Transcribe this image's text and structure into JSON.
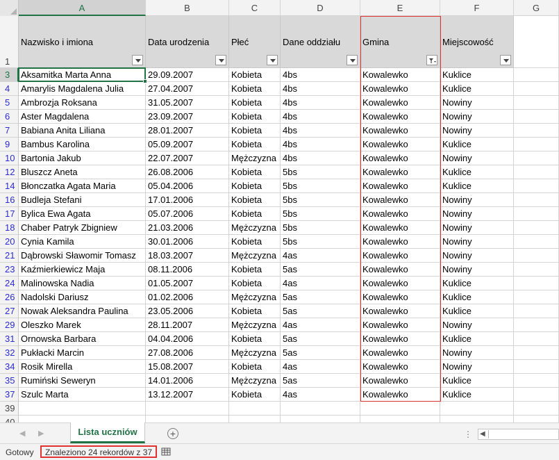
{
  "columns": [
    {
      "letter": "A",
      "header": "Nazwisko i imiona"
    },
    {
      "letter": "B",
      "header": "Data urodzenia"
    },
    {
      "letter": "C",
      "header": "Płeć"
    },
    {
      "letter": "D",
      "header": "Dane oddziału"
    },
    {
      "letter": "E",
      "header": "Gmina"
    },
    {
      "letter": "F",
      "header": "Miejscowość"
    },
    {
      "letter": "G",
      "header": ""
    }
  ],
  "header_row_number": "1",
  "active_filter_column": "E",
  "rows": [
    {
      "n": "3",
      "cells": [
        "Aksamitka Marta Anna",
        "29.09.2007",
        "Kobieta",
        "4bs",
        "Kowalewko",
        "Kuklice"
      ]
    },
    {
      "n": "4",
      "cells": [
        "Amarylis Magdalena Julia",
        "27.04.2007",
        "Kobieta",
        "4bs",
        "Kowalewko",
        "Kuklice"
      ]
    },
    {
      "n": "5",
      "cells": [
        "Ambrozja Roksana",
        "31.05.2007",
        "Kobieta",
        "4bs",
        "Kowalewko",
        "Nowiny"
      ]
    },
    {
      "n": "6",
      "cells": [
        "Aster Magdalena",
        "23.09.2007",
        "Kobieta",
        "4bs",
        "Kowalewko",
        "Nowiny"
      ]
    },
    {
      "n": "7",
      "cells": [
        "Babiana Anita Liliana",
        "28.01.2007",
        "Kobieta",
        "4bs",
        "Kowalewko",
        "Nowiny"
      ]
    },
    {
      "n": "9",
      "cells": [
        "Bambus Karolina",
        "05.09.2007",
        "Kobieta",
        "4bs",
        "Kowalewko",
        "Kuklice"
      ]
    },
    {
      "n": "10",
      "cells": [
        "Bartonia Jakub",
        "22.07.2007",
        "Mężczyzna",
        "4bs",
        "Kowalewko",
        "Nowiny"
      ]
    },
    {
      "n": "12",
      "cells": [
        "Bluszcz Aneta",
        "26.08.2006",
        "Kobieta",
        "5bs",
        "Kowalewko",
        "Kuklice"
      ]
    },
    {
      "n": "14",
      "cells": [
        "Błonczatka Agata Maria",
        "05.04.2006",
        "Kobieta",
        "5bs",
        "Kowalewko",
        "Kuklice"
      ]
    },
    {
      "n": "16",
      "cells": [
        "Budleja Stefani",
        "17.01.2006",
        "Kobieta",
        "5bs",
        "Kowalewko",
        "Nowiny"
      ]
    },
    {
      "n": "17",
      "cells": [
        "Bylica Ewa Agata",
        "05.07.2006",
        "Kobieta",
        "5bs",
        "Kowalewko",
        "Nowiny"
      ]
    },
    {
      "n": "18",
      "cells": [
        "Chaber Patryk Zbigniew",
        "21.03.2006",
        "Mężczyzna",
        "5bs",
        "Kowalewko",
        "Nowiny"
      ]
    },
    {
      "n": "20",
      "cells": [
        "Cynia Kamila",
        "30.01.2006",
        "Kobieta",
        "5bs",
        "Kowalewko",
        "Nowiny"
      ]
    },
    {
      "n": "21",
      "cells": [
        "Dąbrowski Sławomir Tomasz",
        "18.03.2007",
        "Mężczyzna",
        "4as",
        "Kowalewko",
        "Nowiny"
      ]
    },
    {
      "n": "23",
      "cells": [
        "Kaźmierkiewicz Maja",
        "08.11.2006",
        "Kobieta",
        "5as",
        "Kowalewko",
        "Nowiny"
      ]
    },
    {
      "n": "24",
      "cells": [
        "Malinowska Nadia",
        "01.05.2007",
        "Kobieta",
        "4as",
        "Kowalewko",
        "Kuklice"
      ]
    },
    {
      "n": "26",
      "cells": [
        "Nadolski Dariusz",
        "01.02.2006",
        "Mężczyzna",
        "5as",
        "Kowalewko",
        "Kuklice"
      ]
    },
    {
      "n": "27",
      "cells": [
        "Nowak Aleksandra Paulina",
        "23.05.2006",
        "Kobieta",
        "5as",
        "Kowalewko",
        "Kuklice"
      ]
    },
    {
      "n": "29",
      "cells": [
        "Oleszko Marek",
        "28.11.2007",
        "Mężczyzna",
        "4as",
        "Kowalewko",
        "Nowiny"
      ]
    },
    {
      "n": "31",
      "cells": [
        "Ornowska Barbara",
        "04.04.2006",
        "Kobieta",
        "5as",
        "Kowalewko",
        "Kuklice"
      ]
    },
    {
      "n": "32",
      "cells": [
        "Pukłacki Marcin",
        "27.08.2006",
        "Mężczyzna",
        "5as",
        "Kowalewko",
        "Nowiny"
      ]
    },
    {
      "n": "34",
      "cells": [
        "Rosik Mirella",
        "15.08.2007",
        "Kobieta",
        "4as",
        "Kowalewko",
        "Nowiny"
      ]
    },
    {
      "n": "35",
      "cells": [
        "Rumiński Seweryn",
        "14.01.2006",
        "Mężczyzna",
        "5as",
        "Kowalewko",
        "Kuklice"
      ]
    },
    {
      "n": "37",
      "cells": [
        "Szulc Marta",
        "13.12.2007",
        "Kobieta",
        "4as",
        "Kowalewko",
        "Kuklice"
      ]
    }
  ],
  "empty_rows": [
    "39",
    "40"
  ],
  "sheet_tab": "Lista uczniów",
  "status": {
    "ready": "Gotowy",
    "filter_message": "Znaleziono 24 rekordów z 37"
  },
  "icons": {
    "add_sheet": "plus-circle-icon",
    "filter": "funnel-icon",
    "dropdown": "chevron-down-icon",
    "status_view": "table-view-icon"
  },
  "colors": {
    "accent": "#217346",
    "highlight_border": "#e0322e",
    "filtered_row_number": "#2b2bd0",
    "header_fill": "#d9d9d9"
  }
}
